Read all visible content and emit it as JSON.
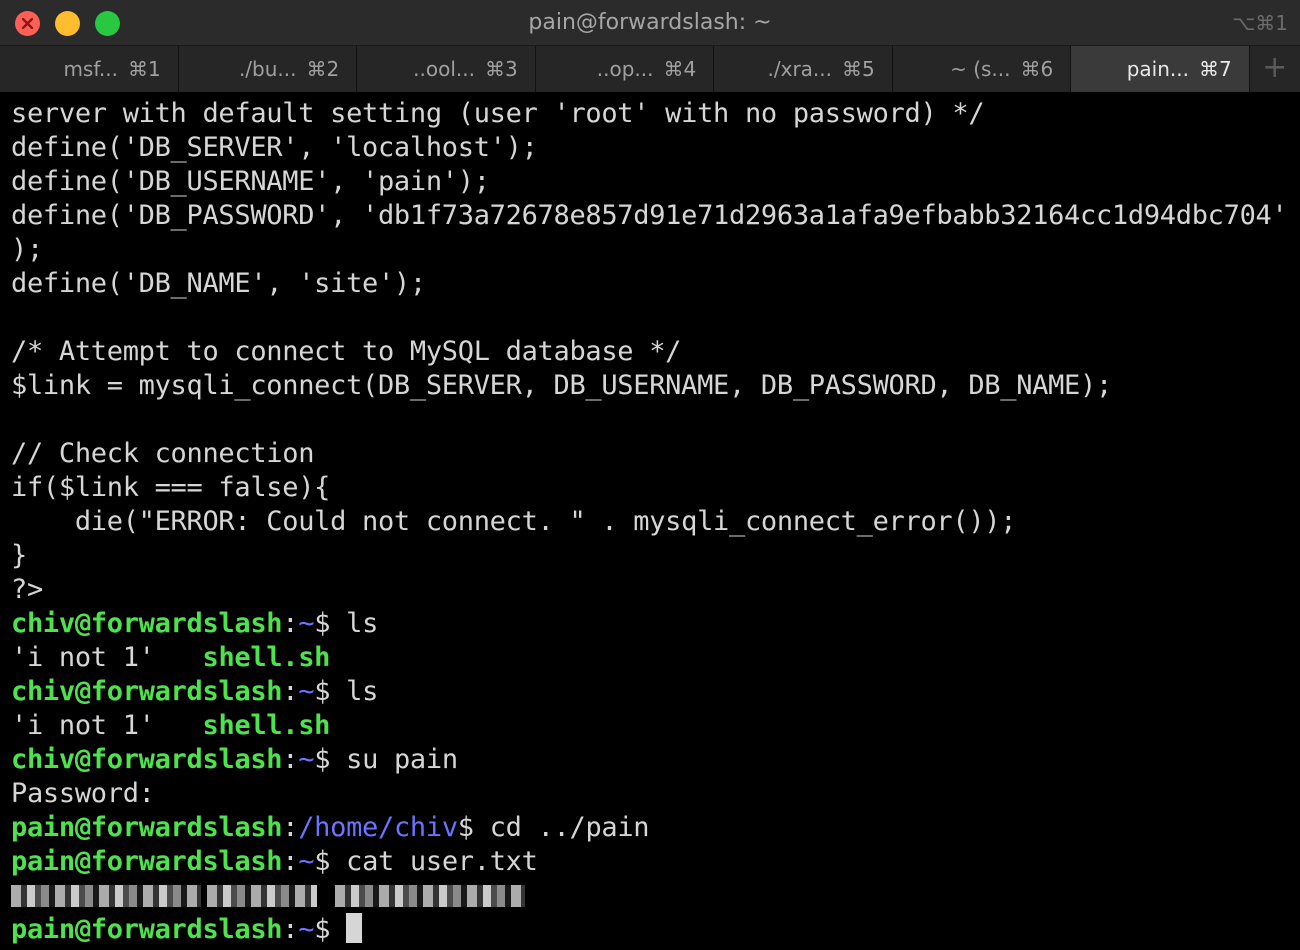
{
  "window": {
    "title": "pain@forwardslash: ~",
    "shortcut": "⌥⌘1"
  },
  "tabs": [
    {
      "label": "msf...",
      "key": "⌘1"
    },
    {
      "label": "./bu...",
      "key": "⌘2"
    },
    {
      "label": "..ool...",
      "key": "⌘3"
    },
    {
      "label": "..op...",
      "key": "⌘4"
    },
    {
      "label": "./xra...",
      "key": "⌘5"
    },
    {
      "label": "~ (s...",
      "key": "⌘6"
    },
    {
      "label": "pain...",
      "key": "⌘7"
    }
  ],
  "add_tab": "+",
  "terminal": {
    "code_lines": [
      "server with default setting (user 'root' with no password) */",
      "define('DB_SERVER', 'localhost');",
      "define('DB_USERNAME', 'pain');",
      "define('DB_PASSWORD', 'db1f73a72678e857d91e71d2963a1afa9efbabb32164cc1d94dbc704'",
      ");",
      "define('DB_NAME', 'site');",
      "",
      "/* Attempt to connect to MySQL database */",
      "$link = mysqli_connect(DB_SERVER, DB_USERNAME, DB_PASSWORD, DB_NAME);",
      "",
      "// Check connection",
      "if($link === false){",
      "    die(\"ERROR: Could not connect. \" . mysqli_connect_error());",
      "}",
      "?>"
    ],
    "prompt1": {
      "user": "chiv@forwardslash",
      "path": "~",
      "cmd": " ls"
    },
    "ls1": {
      "file1": "'i not 1'",
      "gap": "   ",
      "file2": "shell.sh"
    },
    "prompt2": {
      "user": "chiv@forwardslash",
      "path": "~",
      "cmd": " ls"
    },
    "ls2": {
      "file1": "'i not 1'",
      "gap": "   ",
      "file2": "shell.sh"
    },
    "prompt3": {
      "user": "chiv@forwardslash",
      "path": "~",
      "cmd": " su pain"
    },
    "password_prompt": "Password:",
    "prompt4": {
      "user": "pain@forwardslash",
      "path": "/home/chiv",
      "cmd": " cd ../pain"
    },
    "prompt5": {
      "user": "pain@forwardslash",
      "path": "~",
      "cmd": " cat user.txt"
    },
    "prompt6": {
      "user": "pain@forwardslash",
      "path": "~",
      "cmd": " "
    },
    "sep": ":",
    "dollar": "$"
  }
}
